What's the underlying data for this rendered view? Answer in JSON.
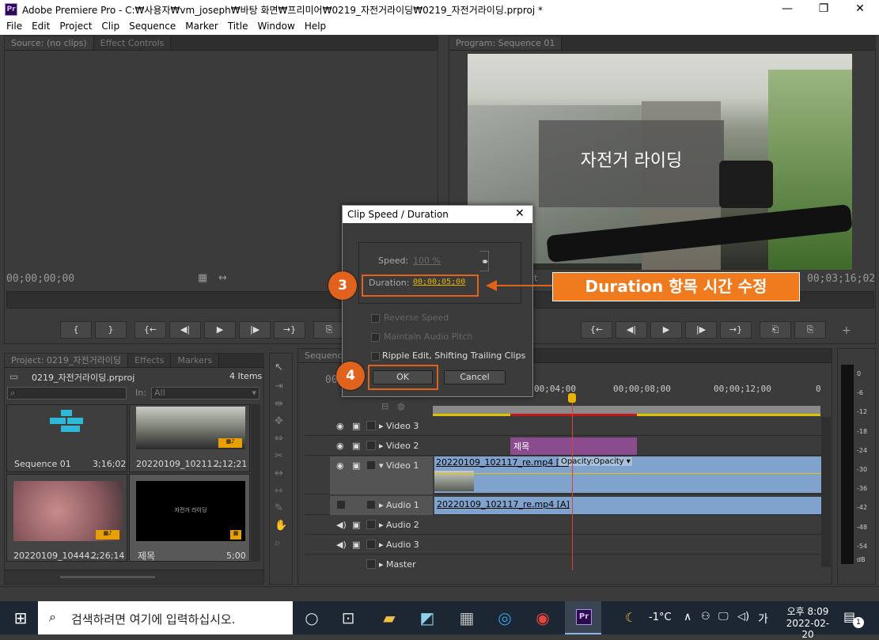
{
  "window": {
    "title": "Adobe Premiere Pro - C:₩사용자₩vm_joseph₩바탕 화면₩프리미어₩0219_자전거라이딩₩0219_자전거라이딩.prproj *",
    "logo": "Pr",
    "minimize": "—",
    "maximize": "❐",
    "close": "✕"
  },
  "menu": [
    "File",
    "Edit",
    "Project",
    "Clip",
    "Sequence",
    "Marker",
    "Title",
    "Window",
    "Help"
  ],
  "source": {
    "tabs": [
      "Source: (no clips)",
      "Effect Controls"
    ],
    "timecode": "00;00;00;00"
  },
  "program": {
    "tab": "Program: Sequence 01",
    "title_text": "자전거 라이딩",
    "timecode_right": "00;03;16;02",
    "partial_label": "it"
  },
  "project": {
    "tabs": [
      "Project: 0219_자전거라이딩",
      "Effects",
      "Markers"
    ],
    "file": "0219_자전거라이딩.prproj",
    "item_count": "4 Items",
    "in_label": "In:",
    "in_value": "All",
    "items": [
      {
        "name": "Sequence 01",
        "duration": "3;16;02"
      },
      {
        "name": "20220109_10211...",
        "duration": "2;12;21"
      },
      {
        "name": "20220109_10444...",
        "duration": "2;26;14"
      },
      {
        "name": "제목",
        "duration": "5;00",
        "thumb_text": "자전거 라이딩"
      }
    ]
  },
  "timeline": {
    "tab": "Sequence",
    "timecode": "00",
    "ruler": [
      "00;04;00",
      "00;00;08;00",
      "00;00;12;00",
      "0"
    ],
    "tracks": [
      {
        "name": "Video 3"
      },
      {
        "name": "Video 2",
        "clip": "제목"
      },
      {
        "name": "Video 1",
        "clip": "20220109_102117_re.mp4 [V]",
        "opacity": "Opacity:Opacity ▾"
      },
      {
        "name": "Audio 1",
        "clip": "20220109_102117_re.mp4 [A]"
      },
      {
        "name": "Audio 2"
      },
      {
        "name": "Audio 3"
      },
      {
        "name": "Master"
      }
    ]
  },
  "meter": {
    "labels": [
      "0",
      "-6",
      "-12",
      "-18",
      "-24",
      "-30",
      "-36",
      "-42",
      "-48",
      "-54",
      "dB"
    ]
  },
  "dialog": {
    "title": "Clip Speed / Duration",
    "speed_label": "Speed:",
    "speed_value": "100 %",
    "duration_label": "Duration:",
    "duration_value": "00;00;05;00",
    "reverse": "Reverse Speed",
    "maintain": "Maintain Audio Pitch",
    "ripple": "Ripple Edit, Shifting Trailing Clips",
    "ok": "OK",
    "cancel": "Cancel"
  },
  "annotation": {
    "callout": "Duration 항목 시간 수정",
    "step3": "3",
    "step4": "4",
    "color": "#e0621d"
  },
  "taskbar": {
    "search_placeholder": "검색하려면 여기에 입력하십시오.",
    "weather": "-1°C",
    "ime": "가",
    "time": "오후 8:09",
    "date": "2022-02-20",
    "notify_count": "1"
  }
}
